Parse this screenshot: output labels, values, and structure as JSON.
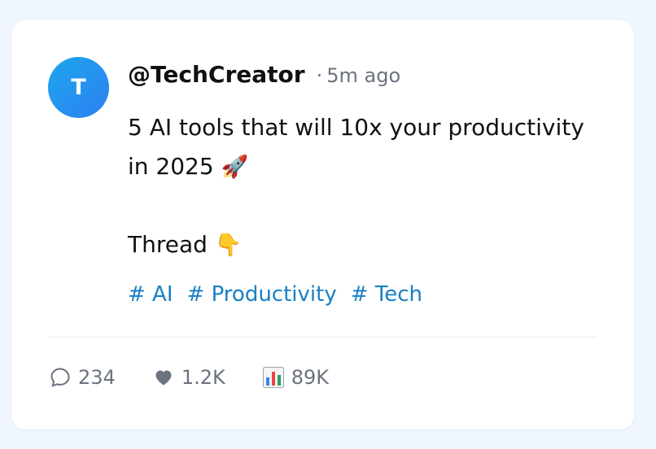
{
  "post": {
    "avatar_initial": "T",
    "handle": "@TechCreator",
    "separator": "·",
    "time": "5m ago",
    "lines": [
      "5 AI tools that will 10x your productivity",
      "in 2025",
      "",
      "Thread"
    ],
    "line2_emoji": "🚀",
    "line4_emoji": "👇",
    "tags": [
      "# AI",
      "# Productivity",
      "# Tech"
    ]
  },
  "stats": {
    "comments": "234",
    "likes": "1.2K",
    "views": "89K"
  },
  "icons": {
    "comments": "comment-bubble-icon",
    "likes": "heart-icon",
    "views": "bar-chart-icon"
  },
  "colors": {
    "page_background": "#eff6fe",
    "card_background": "#ffffff",
    "avatar_gradient_start": "#1ca6ec",
    "avatar_gradient_end": "#2e80f2",
    "tag_color": "#1a7fc4",
    "muted_text": "#6b7280"
  }
}
